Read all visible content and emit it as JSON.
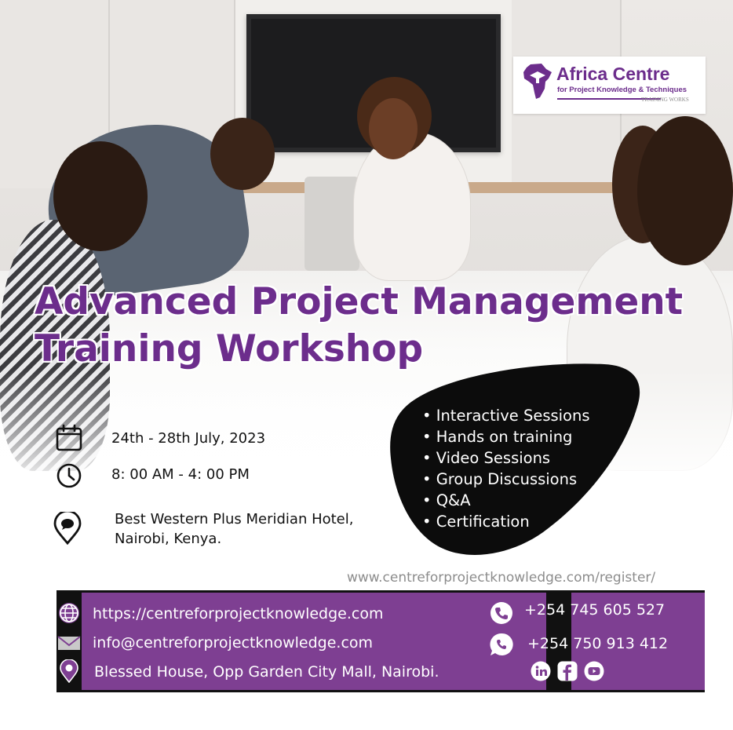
{
  "logo": {
    "title": "Africa Centre",
    "subtitle": "for Project Knowledge & Techniques",
    "tagline": "TRAINING WORKS",
    "color": "#6c2d8c"
  },
  "title": {
    "line1": "Advanced Project Management",
    "line2": "Training Workshop"
  },
  "details": {
    "date": "24th - 28th July, 2023",
    "time": "8: 00 AM - 4: 00 PM",
    "venue_line1": "Best Western Plus Meridian Hotel,",
    "venue_line2": "Nairobi, Kenya."
  },
  "features": [
    "• Interactive Sessions",
    "• Hands on training",
    "• Video Sessions",
    "• Group Discussions",
    "• Q&A",
    "• Certification"
  ],
  "register_url": "www.centreforprojectknowledge.com/register/",
  "footer": {
    "website": "https://centreforprojectknowledge.com",
    "email": "info@centreforprojectknowledge.com",
    "address": "Blessed House, Opp Garden City Mall, Nairobi.",
    "phone": "+254 745 605 527",
    "whatsapp": "+254 750 913 412",
    "social_icons": [
      "linkedin-icon",
      "facebook-icon",
      "youtube-icon"
    ]
  },
  "colors": {
    "brand_purple": "#6c2d8c",
    "footer_purple": "#7e3f92",
    "black": "#111111"
  }
}
